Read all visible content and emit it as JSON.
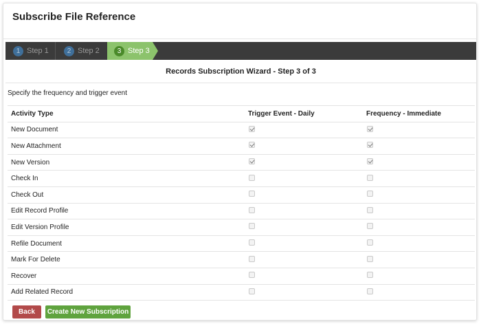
{
  "header": {
    "title": "Subscribe File Reference"
  },
  "steps": [
    {
      "number": "1",
      "label": "Step 1",
      "active": false
    },
    {
      "number": "2",
      "label": "Step 2",
      "active": false
    },
    {
      "number": "3",
      "label": "Step 3",
      "active": true
    }
  ],
  "wizard": {
    "title": "Records Subscription Wizard - Step 3 of 3",
    "instructions": "Specify the frequency and trigger event"
  },
  "table": {
    "headers": [
      "Activity Type",
      "Trigger Event - Daily",
      "Frequency - Immediate"
    ],
    "rows": [
      {
        "activity": "New Document",
        "trigger": true,
        "frequency": true
      },
      {
        "activity": "New Attachment",
        "trigger": true,
        "frequency": true
      },
      {
        "activity": "New Version",
        "trigger": true,
        "frequency": true
      },
      {
        "activity": "Check In",
        "trigger": false,
        "frequency": false
      },
      {
        "activity": "Check Out",
        "trigger": false,
        "frequency": false
      },
      {
        "activity": "Edit Record Profile",
        "trigger": false,
        "frequency": false
      },
      {
        "activity": "Edit Version Profile",
        "trigger": false,
        "frequency": false
      },
      {
        "activity": "Refile Document",
        "trigger": false,
        "frequency": false
      },
      {
        "activity": "Mark For Delete",
        "trigger": false,
        "frequency": false
      },
      {
        "activity": "Recover",
        "trigger": false,
        "frequency": false
      },
      {
        "activity": "Add Related Record",
        "trigger": false,
        "frequency": false
      }
    ]
  },
  "buttons": {
    "back_label": "Back",
    "create_label": "Create New Subscription"
  },
  "colors": {
    "step_active": "#8cc36c",
    "step_bar": "#3b3b3b",
    "back_button": "#b24a4a",
    "create_button": "#5fa33e"
  }
}
